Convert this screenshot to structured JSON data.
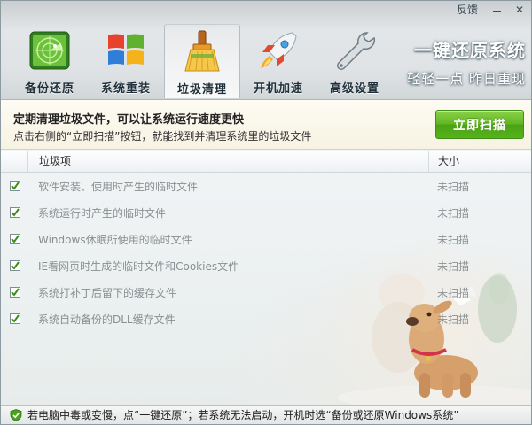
{
  "window": {
    "feedback_label": "反馈",
    "minimize_label": "—",
    "close_label": "✕"
  },
  "toolbar": {
    "items": [
      {
        "label": "备份还原",
        "icon": "radar-icon",
        "active": false
      },
      {
        "label": "系统重装",
        "icon": "windows-logo-icon",
        "active": false
      },
      {
        "label": "垃圾清理",
        "icon": "broom-icon",
        "active": true
      },
      {
        "label": "开机加速",
        "icon": "rocket-icon",
        "active": false
      },
      {
        "label": "高级设置",
        "icon": "wrench-icon",
        "active": false
      }
    ]
  },
  "brand": {
    "title": "一键还原系统",
    "slogan": "轻轻一点  昨日重现"
  },
  "info": {
    "headline": "定期清理垃圾文件，可以让系统运行速度更快",
    "hint": "点击右侧的“立即扫描”按钮，就能找到并清理系统里的垃圾文件",
    "scan_button": "立即扫描"
  },
  "table": {
    "headers": {
      "item": "垃圾项",
      "size": "大小"
    },
    "rows": [
      {
        "item": "软件安装、使用时产生的临时文件",
        "size": "未扫描",
        "checked": true
      },
      {
        "item": "系统运行时产生的临时文件",
        "size": "未扫描",
        "checked": true
      },
      {
        "item": "Windows休眠所使用的临时文件",
        "size": "未扫描",
        "checked": true
      },
      {
        "item": "IE看网页时生成的临时文件和Cookies文件",
        "size": "未扫描",
        "checked": true
      },
      {
        "item": "系统打补丁后留下的缓存文件",
        "size": "未扫描",
        "checked": true
      },
      {
        "item": "系统自动备份的DLL缓存文件",
        "size": "未扫描",
        "checked": true
      }
    ]
  },
  "status": {
    "text": "若电脑中毒或变慢，点“一键还原”；若系统无法启动，开机时选“备份或还原Windows系统”"
  },
  "colors": {
    "accent_green": "#5fb522",
    "check_green": "#3a8f1a"
  }
}
